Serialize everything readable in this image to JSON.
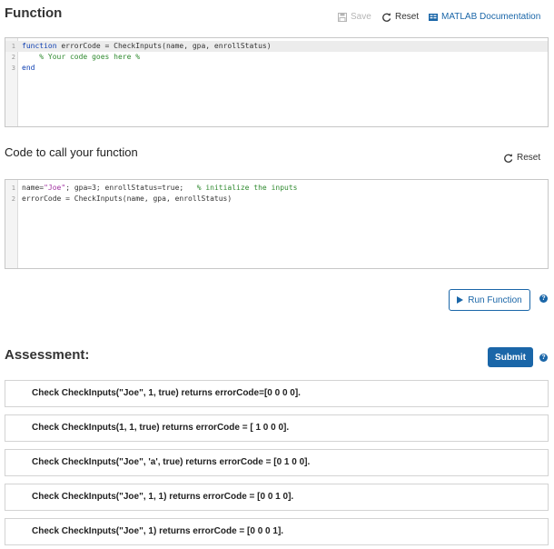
{
  "function_section": {
    "title": "Function",
    "save_label": "Save",
    "reset_label": "Reset",
    "docs_label": "MATLAB Documentation",
    "code_lines": [
      {
        "num": "1",
        "parts": [
          {
            "t": "function",
            "c": "kw"
          },
          {
            "t": " errorCode = CheckInputs(name, gpa, enrollStatus)",
            "c": "fn"
          }
        ]
      },
      {
        "num": "2",
        "parts": [
          {
            "t": "    % Your code goes here %",
            "c": "cm"
          }
        ]
      },
      {
        "num": "3",
        "parts": [
          {
            "t": "end",
            "c": "kw"
          }
        ]
      }
    ]
  },
  "call_section": {
    "title": "Code to call your function",
    "reset_label": "Reset",
    "code_lines": [
      {
        "num": "1",
        "parts": [
          {
            "t": "name=",
            "c": "fn"
          },
          {
            "t": "\"Joe\"",
            "c": "str"
          },
          {
            "t": "; gpa=3; enrollStatus=true;   ",
            "c": "fn"
          },
          {
            "t": "% initialize the inputs",
            "c": "cm"
          }
        ]
      },
      {
        "num": "2",
        "parts": [
          {
            "t": "errorCode = CheckInputs(name, gpa, enrollStatus)",
            "c": "fn"
          }
        ]
      }
    ],
    "run_label": "Run Function",
    "help_glyph": "?"
  },
  "assessment": {
    "title": "Assessment:",
    "submit_label": "Submit",
    "help_glyph": "?",
    "checks": [
      "Check CheckInputs(\"Joe\", 1, true) returns errorCode=[0 0 0 0].",
      "Check CheckInputs(1, 1, true) returns errorCode = [ 1 0 0 0].",
      "Check CheckInputs(\"Joe\", 'a', true) returns errorCode = [0 1 0 0].",
      "Check CheckInputs(\"Joe\", 1, 1) returns errorCode = [0 0 1 0].",
      "Check CheckInputs(\"Joe\", 1) returns errorCode = [0 0 0 1]."
    ]
  },
  "colors": {
    "accent": "#1a66a8",
    "keyword": "#0e3fb2",
    "comment": "#2f8a2f",
    "string": "#a030a0"
  }
}
